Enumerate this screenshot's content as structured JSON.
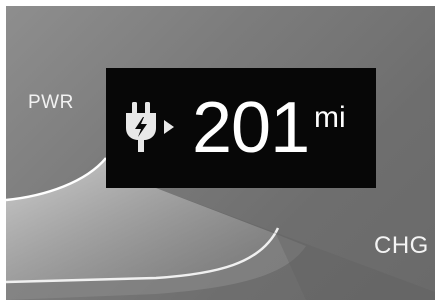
{
  "gauge": {
    "power_label": "PWR",
    "charge_label": "CHG"
  },
  "range": {
    "value": "201",
    "unit": "mi",
    "icon": "ev-charge-plug-icon"
  },
  "colors": {
    "background": "#7c7c7c",
    "range_box": "#070707",
    "text": "#ffffff"
  }
}
